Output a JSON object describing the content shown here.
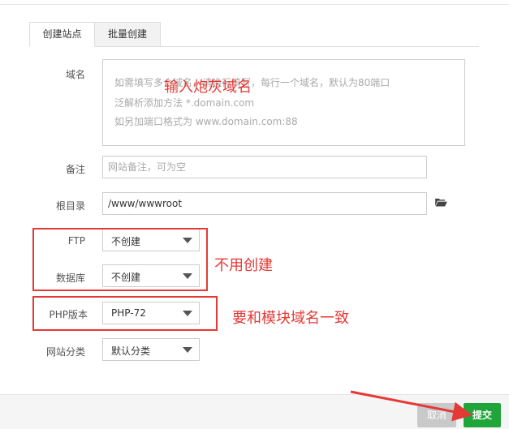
{
  "tabs": [
    {
      "label": "创建站点"
    },
    {
      "label": "批量创建"
    }
  ],
  "form": {
    "domain": {
      "label": "域名",
      "placeholder_lines": [
        "如需填写多个域名，请换行填写，每行一个域名，默认为80端口",
        "泛解析添加方法 *.domain.com",
        "如另加端口格式为 www.domain.com:88"
      ]
    },
    "remark": {
      "label": "备注",
      "placeholder": "网站备注，可为空"
    },
    "root": {
      "label": "根目录",
      "value": "/www/wwwroot"
    },
    "ftp": {
      "label": "FTP",
      "value": "不创建"
    },
    "database": {
      "label": "数据库",
      "value": "不创建"
    },
    "php": {
      "label": "PHP版本",
      "value": "PHP-72"
    },
    "category": {
      "label": "网站分类",
      "value": "默认分类"
    }
  },
  "annotations": {
    "domain_note": "输入炮灰域名",
    "no_create_note": "不用创建",
    "match_note": "要和模块域名一致",
    "color": "#e53935"
  },
  "footer": {
    "cancel_label": "取消",
    "submit_label": "提交"
  },
  "colors": {
    "submit": "#20a53a",
    "cancel": "#c9c9c9"
  }
}
